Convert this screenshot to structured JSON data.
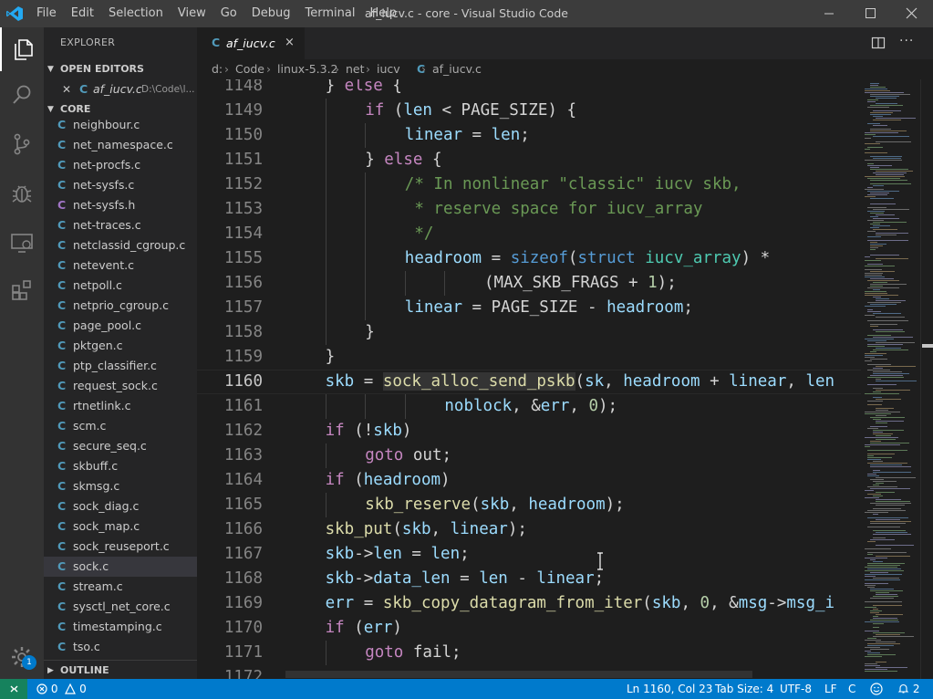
{
  "window": {
    "title": "af_iucv.c - core - Visual Studio Code",
    "menu": [
      "File",
      "Edit",
      "Selection",
      "View",
      "Go",
      "Debug",
      "Terminal",
      "Help"
    ]
  },
  "activity_bar": {
    "icons": [
      "files-icon",
      "search-icon",
      "source-control-icon",
      "debug-icon",
      "remote-explorer-icon",
      "extensions-icon"
    ],
    "settings_badge": "1"
  },
  "sidebar": {
    "title": "EXPLORER",
    "open_editors_header": "OPEN EDITORS",
    "open_editor": {
      "icon": "C",
      "name": "af_iucv.c",
      "path": "D:\\Code\\l..."
    },
    "folder_header": "CORE",
    "outline_header": "OUTLINE",
    "files": [
      {
        "name": "neighbour.c",
        "type": "c"
      },
      {
        "name": "net_namespace.c",
        "type": "c"
      },
      {
        "name": "net-procfs.c",
        "type": "c"
      },
      {
        "name": "net-sysfs.c",
        "type": "c"
      },
      {
        "name": "net-sysfs.h",
        "type": "h"
      },
      {
        "name": "net-traces.c",
        "type": "c"
      },
      {
        "name": "netclassid_cgroup.c",
        "type": "c"
      },
      {
        "name": "netevent.c",
        "type": "c"
      },
      {
        "name": "netpoll.c",
        "type": "c"
      },
      {
        "name": "netprio_cgroup.c",
        "type": "c"
      },
      {
        "name": "page_pool.c",
        "type": "c"
      },
      {
        "name": "pktgen.c",
        "type": "c"
      },
      {
        "name": "ptp_classifier.c",
        "type": "c"
      },
      {
        "name": "request_sock.c",
        "type": "c"
      },
      {
        "name": "rtnetlink.c",
        "type": "c"
      },
      {
        "name": "scm.c",
        "type": "c"
      },
      {
        "name": "secure_seq.c",
        "type": "c"
      },
      {
        "name": "skbuff.c",
        "type": "c"
      },
      {
        "name": "skmsg.c",
        "type": "c"
      },
      {
        "name": "sock_diag.c",
        "type": "c"
      },
      {
        "name": "sock_map.c",
        "type": "c"
      },
      {
        "name": "sock_reuseport.c",
        "type": "c"
      },
      {
        "name": "sock.c",
        "type": "c",
        "selected": true
      },
      {
        "name": "stream.c",
        "type": "c"
      },
      {
        "name": "sysctl_net_core.c",
        "type": "c"
      },
      {
        "name": "timestamping.c",
        "type": "c"
      },
      {
        "name": "tso.c",
        "type": "c"
      }
    ]
  },
  "editor": {
    "tab": {
      "icon": "C",
      "label": "af_iucv.c",
      "close": "×"
    },
    "more_actions": "···",
    "breadcrumb": [
      "d:",
      "Code",
      "linux-5.3.2",
      "net",
      "iucv",
      "af_iucv.c"
    ],
    "breadcrumb_file_icon": "C",
    "current_line": "1160",
    "lines": [
      {
        "n": "1148",
        "indent": 1,
        "tokens": [
          [
            "",
            "} "
          ],
          [
            "c",
            "else"
          ],
          [
            "",
            " {"
          ]
        ]
      },
      {
        "n": "1149",
        "indent": 2,
        "tokens": [
          [
            "c",
            "if"
          ],
          [
            "",
            " ("
          ],
          [
            "v",
            "len"
          ],
          [
            "",
            " < PAGE_SIZE) {"
          ]
        ]
      },
      {
        "n": "1150",
        "indent": 3,
        "tokens": [
          [
            "v",
            "linear"
          ],
          [
            "",
            " = "
          ],
          [
            "v",
            "len"
          ],
          [
            "",
            ";"
          ]
        ]
      },
      {
        "n": "1151",
        "indent": 2,
        "tokens": [
          [
            "",
            "} "
          ],
          [
            "c",
            "else"
          ],
          [
            "",
            " {"
          ]
        ]
      },
      {
        "n": "1152",
        "indent": 3,
        "tokens": [
          [
            "m",
            "/* In nonlinear \"classic\" iucv skb,"
          ]
        ]
      },
      {
        "n": "1153",
        "indent": 3,
        "tokens": [
          [
            "m",
            " * reserve space for iucv_array"
          ]
        ]
      },
      {
        "n": "1154",
        "indent": 3,
        "tokens": [
          [
            "m",
            " */"
          ]
        ]
      },
      {
        "n": "1155",
        "indent": 3,
        "tokens": [
          [
            "v",
            "headroom"
          ],
          [
            "",
            " = "
          ],
          [
            "k",
            "sizeof"
          ],
          [
            "",
            "("
          ],
          [
            "k",
            "struct"
          ],
          [
            "",
            " "
          ],
          [
            "t",
            "iucv_array"
          ],
          [
            "",
            ") *"
          ]
        ]
      },
      {
        "n": "1156",
        "indent": 5,
        "tokens": [
          [
            "",
            "(MAX_SKB_FRAGS + "
          ],
          [
            "n",
            "1"
          ],
          [
            "",
            ");"
          ]
        ]
      },
      {
        "n": "1157",
        "indent": 3,
        "tokens": [
          [
            "v",
            "linear"
          ],
          [
            "",
            " = PAGE_SIZE - "
          ],
          [
            "v",
            "headroom"
          ],
          [
            "",
            ";"
          ]
        ]
      },
      {
        "n": "1158",
        "indent": 2,
        "tokens": [
          [
            "",
            "}"
          ]
        ]
      },
      {
        "n": "1159",
        "indent": 1,
        "tokens": [
          [
            "",
            "}"
          ]
        ]
      },
      {
        "n": "1160",
        "indent": 1,
        "tokens": [
          [
            "v",
            "skb"
          ],
          [
            "",
            " = "
          ],
          [
            "fh",
            "sock_alloc_send_pskb"
          ],
          [
            "",
            "("
          ],
          [
            "v",
            "sk"
          ],
          [
            "",
            ", "
          ],
          [
            "v",
            "headroom"
          ],
          [
            "",
            " + "
          ],
          [
            "v",
            "linear"
          ],
          [
            "",
            ", "
          ],
          [
            "v",
            "len"
          ]
        ]
      },
      {
        "n": "1161",
        "indent": 4,
        "tokens": [
          [
            "v",
            "noblock"
          ],
          [
            "",
            ", &"
          ],
          [
            "v",
            "err"
          ],
          [
            "",
            ", "
          ],
          [
            "n",
            "0"
          ],
          [
            "",
            ");"
          ]
        ]
      },
      {
        "n": "1162",
        "indent": 1,
        "tokens": [
          [
            "c",
            "if"
          ],
          [
            "",
            " (!"
          ],
          [
            "v",
            "skb"
          ],
          [
            "",
            ")"
          ]
        ]
      },
      {
        "n": "1163",
        "indent": 2,
        "tokens": [
          [
            "c",
            "goto"
          ],
          [
            "",
            " out;"
          ]
        ]
      },
      {
        "n": "1164",
        "indent": 1,
        "tokens": [
          [
            "c",
            "if"
          ],
          [
            "",
            " ("
          ],
          [
            "v",
            "headroom"
          ],
          [
            "",
            ")"
          ]
        ]
      },
      {
        "n": "1165",
        "indent": 2,
        "tokens": [
          [
            "f",
            "skb_reserve"
          ],
          [
            "",
            "("
          ],
          [
            "v",
            "skb"
          ],
          [
            "",
            ", "
          ],
          [
            "v",
            "headroom"
          ],
          [
            "",
            ");"
          ]
        ]
      },
      {
        "n": "1166",
        "indent": 1,
        "tokens": [
          [
            "f",
            "skb_put"
          ],
          [
            "",
            "("
          ],
          [
            "v",
            "skb"
          ],
          [
            "",
            ", "
          ],
          [
            "v",
            "linear"
          ],
          [
            "",
            ");"
          ]
        ]
      },
      {
        "n": "1167",
        "indent": 1,
        "tokens": [
          [
            "v",
            "skb"
          ],
          [
            "",
            "->"
          ],
          [
            "v",
            "len"
          ],
          [
            "",
            " = "
          ],
          [
            "v",
            "len"
          ],
          [
            "",
            ";"
          ]
        ]
      },
      {
        "n": "1168",
        "indent": 1,
        "tokens": [
          [
            "v",
            "skb"
          ],
          [
            "",
            "->"
          ],
          [
            "v",
            "data_len"
          ],
          [
            "",
            " = "
          ],
          [
            "v",
            "len"
          ],
          [
            "",
            " - "
          ],
          [
            "v",
            "linear"
          ],
          [
            "",
            ";"
          ]
        ]
      },
      {
        "n": "1169",
        "indent": 1,
        "tokens": [
          [
            "v",
            "err"
          ],
          [
            "",
            " = "
          ],
          [
            "f",
            "skb_copy_datagram_from_iter"
          ],
          [
            "",
            "("
          ],
          [
            "v",
            "skb"
          ],
          [
            "",
            ", "
          ],
          [
            "n",
            "0"
          ],
          [
            "",
            ", &"
          ],
          [
            "v",
            "msg"
          ],
          [
            "",
            "->"
          ],
          [
            "v",
            "msg_i"
          ]
        ]
      },
      {
        "n": "1170",
        "indent": 1,
        "tokens": [
          [
            "c",
            "if"
          ],
          [
            "",
            " ("
          ],
          [
            "v",
            "err"
          ],
          [
            "",
            ")"
          ]
        ]
      },
      {
        "n": "1171",
        "indent": 2,
        "tokens": [
          [
            "c",
            "goto"
          ],
          [
            "",
            " fail;"
          ]
        ]
      },
      {
        "n": "1172",
        "indent": 0,
        "tokens": []
      }
    ]
  },
  "status_bar": {
    "errors": "0",
    "warnings": "0",
    "cursor": "Ln 1160, Col 23",
    "tab_size": "Tab Size: 4",
    "encoding": "UTF-8",
    "eol": "LF",
    "language": "C",
    "notifications": "2"
  },
  "colors": {
    "accent": "#007acc",
    "c_file_icon": "#519aba",
    "h_file_icon": "#a074c4"
  }
}
